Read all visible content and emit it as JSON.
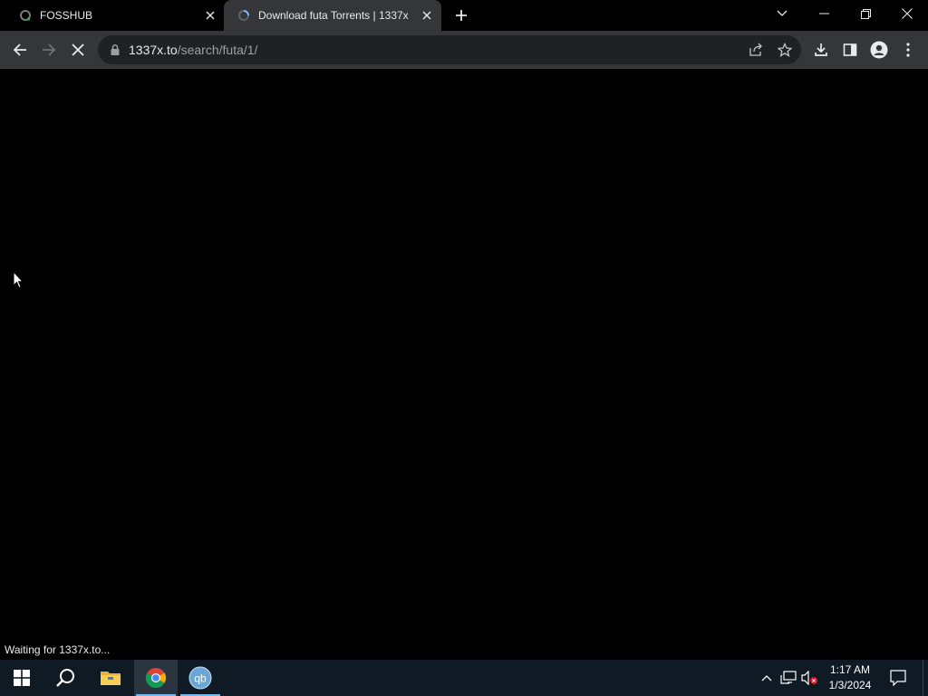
{
  "browser": {
    "tabs": [
      {
        "title": "FOSSHUB",
        "favicon": "fosshub-favicon",
        "active": false
      },
      {
        "title": "Download futa Torrents | 1337x",
        "favicon": "loading-favicon",
        "active": true
      }
    ],
    "address": {
      "host": "1337x.to",
      "path": "/search/futa/1/"
    },
    "status_text": "Waiting for 1337x.to..."
  },
  "taskbar": {
    "apps": [
      {
        "name": "start",
        "icon": "windows-icon"
      },
      {
        "name": "search",
        "icon": "search-icon"
      },
      {
        "name": "file-explorer",
        "icon": "folder-icon"
      },
      {
        "name": "chrome",
        "icon": "chrome-icon",
        "active": true
      },
      {
        "name": "qbittorrent",
        "icon": "qbittorrent-icon",
        "label": "qb"
      }
    ],
    "clock": {
      "time": "1:17 AM",
      "date": "1/3/2024"
    }
  },
  "colors": {
    "tab_active": "#35363a",
    "toolbar": "#35363a",
    "omnibox": "#202124",
    "taskbar": "#0f1a24",
    "accent": "#76b9ed"
  }
}
